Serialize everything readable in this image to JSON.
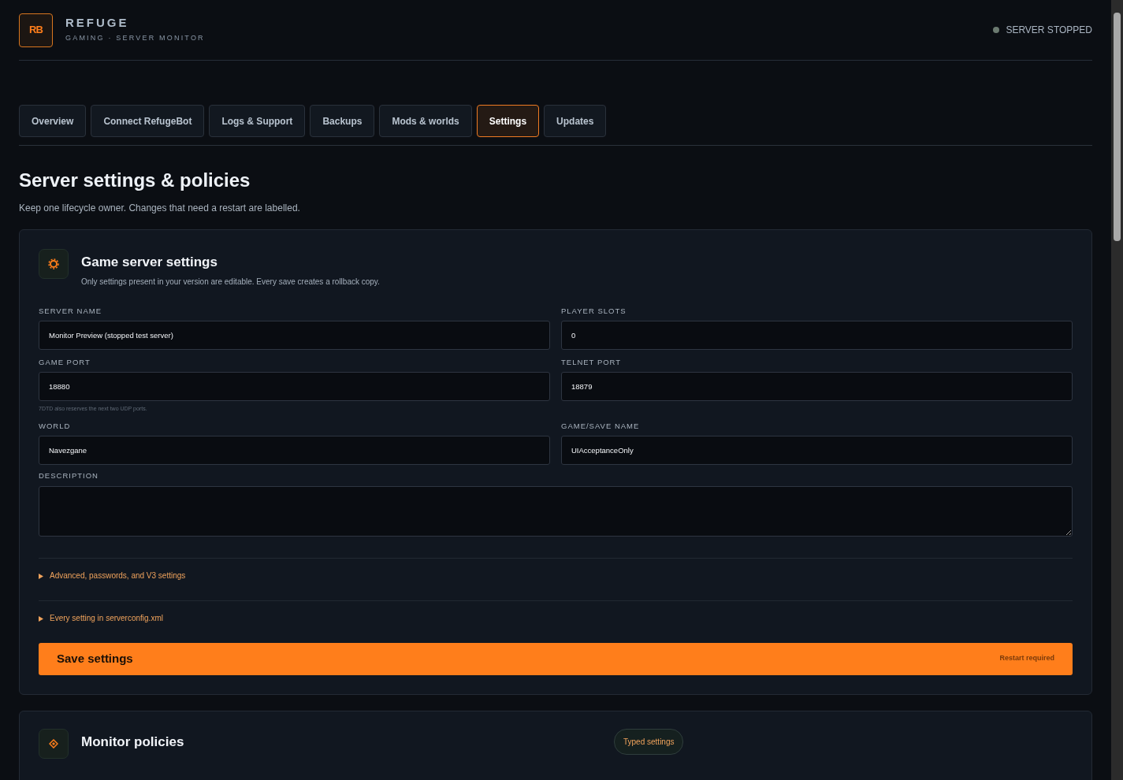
{
  "brand": {
    "logo": "RB",
    "title": "REFUGE",
    "subtitle": "GAMING · SERVER MONITOR"
  },
  "server_status": {
    "label": "SERVER STOPPED",
    "running": false
  },
  "tabs": [
    {
      "label": "Overview",
      "selected": false
    },
    {
      "label": "Connect RefugeBot",
      "selected": false
    },
    {
      "label": "Logs & Support",
      "selected": false
    },
    {
      "label": "Backups",
      "selected": false
    },
    {
      "label": "Mods & worlds",
      "selected": false
    },
    {
      "label": "Settings",
      "selected": true
    },
    {
      "label": "Updates",
      "selected": false
    }
  ],
  "page": {
    "title": "Server settings & policies",
    "subtitle": "Keep one lifecycle owner. Changes that need a restart are labelled."
  },
  "settings_card": {
    "title": "Game server settings",
    "subtitle": "Only settings present in your version are editable. Every save creates a rollback copy.",
    "fields": [
      {
        "label": "SERVER NAME",
        "value": "Monitor Preview (stopped test server)"
      },
      {
        "label": "PLAYER SLOTS",
        "value": "0"
      },
      {
        "label": "GAME PORT",
        "value": "18880",
        "hint": "7DTD also reserves the next two UDP ports."
      },
      {
        "label": "TELNET PORT",
        "value": "18879"
      },
      {
        "label": "WORLD",
        "value": "Navezgane"
      },
      {
        "label": "GAME/SAVE NAME",
        "value": "UIAcceptanceOnly"
      }
    ],
    "description": {
      "label": "DESCRIPTION"
    },
    "sections": [
      {
        "label": "Advanced, passwords, and V3 settings",
        "expanded": false
      },
      {
        "label": "Every setting in serverconfig.xml",
        "expanded": false
      }
    ],
    "save_button": {
      "label": "Save settings",
      "note": "Restart required"
    }
  },
  "policies_card": {
    "title": "Monitor policies",
    "badge": "Typed settings"
  }
}
